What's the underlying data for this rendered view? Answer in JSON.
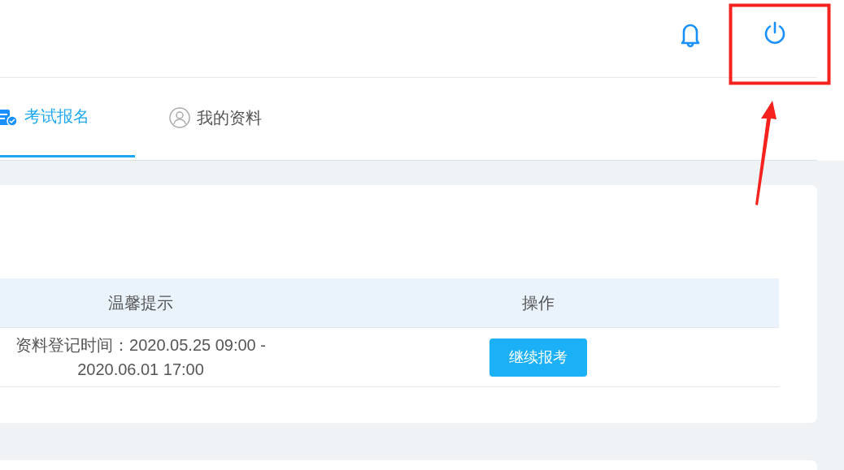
{
  "header": {
    "icons": [
      {
        "kind": "bell"
      },
      {
        "kind": "power"
      }
    ]
  },
  "tabs": [
    {
      "label": "考试报名",
      "selected": true,
      "kind": "form"
    },
    {
      "label": "我的资料",
      "selected": false,
      "kind": "user"
    }
  ],
  "table": {
    "columns": [
      "温馨提示",
      "操作"
    ],
    "rows": [
      {
        "cells": [
          "资料登记时间：2020.05.25 09:00 - 2020.06.01 17:00"
        ],
        "action": "继续报考"
      }
    ]
  }
}
